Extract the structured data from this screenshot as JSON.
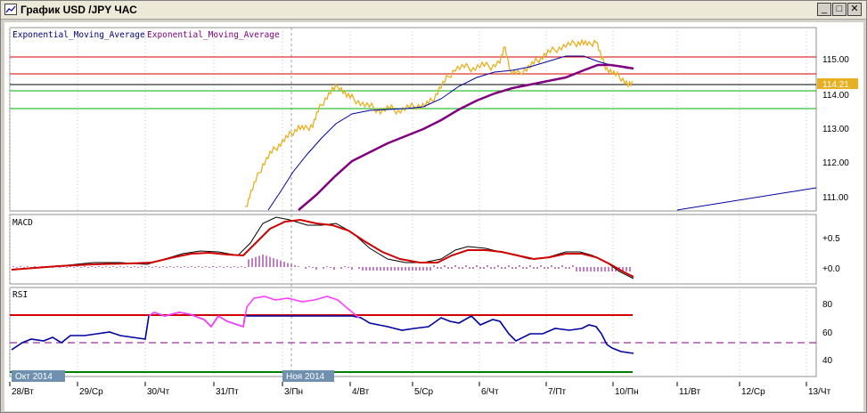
{
  "window": {
    "title": "График USD /JPY  ЧАС",
    "buttons": {
      "minimize": "_",
      "maximize": "□",
      "close": "✕"
    }
  },
  "colors": {
    "price": "#e8b020",
    "ema_fast": "#0000a0",
    "ema_slow": "#800080",
    "resistance": "#d00000",
    "support": "#00b000",
    "current_line": "#000000",
    "macd_line": "#000000",
    "macd_signal": "#d00000",
    "macd_hist": "#800080",
    "rsi_line": "#0000a0",
    "rsi_overbought": "#ff40ff",
    "price_badge": "#e8b020"
  },
  "price_panel": {
    "legend_a": "Exponential_Moving_Average",
    "legend_b": "Exponential_Moving_Average",
    "last_price": "114.21",
    "axis_labels": [
      "115.00",
      "114.00",
      "113.00",
      "112.00",
      "111.00"
    ]
  },
  "macd_panel": {
    "label": "MACD",
    "axis_labels": [
      "+0.5",
      "+0.0"
    ]
  },
  "rsi_panel": {
    "label": "RSI",
    "axis_labels": [
      "80",
      "60",
      "40"
    ]
  },
  "time_axis": {
    "labels": [
      "28/Вт",
      "29/Ср",
      "30/Чт",
      "31/Пт",
      "3/Пн",
      "4/Вт",
      "5/Ср",
      "6/Чт",
      "7/Пт",
      "10/Пн",
      "11/Вт",
      "12/Ср",
      "13/Чт"
    ],
    "month_markers": [
      "Окт 2014",
      "Ноя 2014"
    ]
  },
  "chart_data": {
    "type": "line",
    "series": [
      {
        "name": "Exponential_Moving_Average",
        "values": []
      },
      {
        "name": "Exponential_Moving_Average",
        "values": []
      }
    ],
    "price_levels": {
      "resistance": [
        115.0,
        114.5
      ],
      "support": [
        114.05,
        113.5
      ],
      "current": 114.21
    },
    "rsi_levels": {
      "overbought": 70,
      "mid": 50,
      "oversold": 30
    }
  }
}
